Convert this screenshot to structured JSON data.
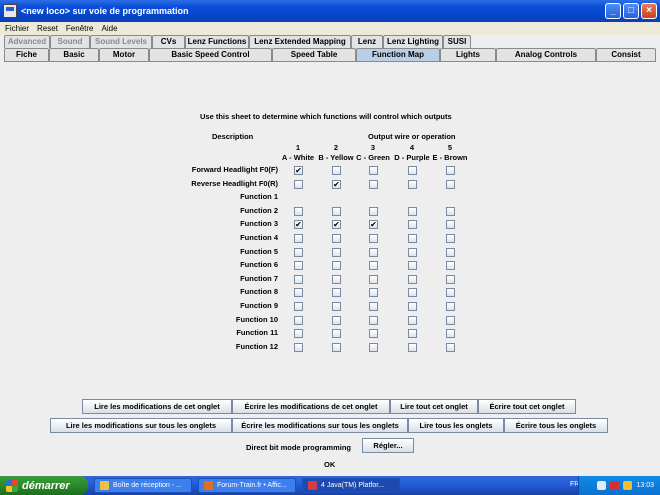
{
  "window": {
    "title": "<new loco> sur voie de programmation"
  },
  "menu": [
    "Fichier",
    "Reset",
    "Fenêtre",
    "Aide"
  ],
  "tabs_row1": [
    {
      "label": "Advanced",
      "enabled": false
    },
    {
      "label": "Sound",
      "enabled": false
    },
    {
      "label": "Sound Levels",
      "enabled": false
    },
    {
      "label": "CVs",
      "enabled": true
    },
    {
      "label": "Lenz Functions",
      "enabled": true
    },
    {
      "label": "Lenz Extended Mapping",
      "enabled": true
    },
    {
      "label": "Lenz",
      "enabled": true
    },
    {
      "label": "Lenz Lighting",
      "enabled": true
    },
    {
      "label": "SUSI",
      "enabled": true
    }
  ],
  "tabs_row2": [
    "Fiche",
    "Basic",
    "Motor",
    "Basic Speed Control",
    "Speed Table",
    "Function Map",
    "Lights",
    "Analog Controls",
    "Consist"
  ],
  "active_tab": "Function Map",
  "function_map": {
    "instructions": "Use this sheet to determine which functions will control which outputs",
    "description_header": "Description",
    "output_header": "Output wire or operation",
    "columns": [
      {
        "num": "1",
        "label": "A - White"
      },
      {
        "num": "2",
        "label": "B - Yellow"
      },
      {
        "num": "3",
        "label": "C - Green"
      },
      {
        "num": "4",
        "label": "D - Purple"
      },
      {
        "num": "5",
        "label": "E - Brown"
      }
    ],
    "rows": [
      {
        "label": "Forward Headlight F0(F)",
        "checks": [
          true,
          false,
          false,
          false,
          false
        ]
      },
      {
        "label": "Reverse Headlight F0(R)",
        "checks": [
          false,
          true,
          false,
          false,
          false
        ]
      },
      {
        "label": "Function 1",
        "checks": null
      },
      {
        "label": "Function 2",
        "checks": [
          false,
          false,
          false,
          false,
          false
        ]
      },
      {
        "label": "Function 3",
        "checks": [
          true,
          true,
          true,
          false,
          false
        ]
      },
      {
        "label": "Function 4",
        "checks": [
          false,
          false,
          false,
          false,
          false
        ]
      },
      {
        "label": "Function 5",
        "checks": [
          false,
          false,
          false,
          false,
          false
        ]
      },
      {
        "label": "Function 6",
        "checks": [
          false,
          false,
          false,
          false,
          false
        ]
      },
      {
        "label": "Function 7",
        "checks": [
          false,
          false,
          false,
          false,
          false
        ]
      },
      {
        "label": "Function 8",
        "checks": [
          false,
          false,
          false,
          false,
          false
        ]
      },
      {
        "label": "Function 9",
        "checks": [
          false,
          false,
          false,
          false,
          false
        ]
      },
      {
        "label": "Function 10",
        "checks": [
          false,
          false,
          false,
          false,
          false
        ]
      },
      {
        "label": "Function 11",
        "checks": [
          false,
          false,
          false,
          false,
          false
        ]
      },
      {
        "label": "Function 12",
        "checks": [
          false,
          false,
          false,
          false,
          false
        ]
      }
    ]
  },
  "buttons": {
    "read_changes_tab": "Lire les modifications de cet onglet",
    "write_changes_tab": "Écrire les modifications de cet onglet",
    "read_all_tab": "Lire tout cet onglet",
    "write_all_tab": "Écrire tout cet onglet",
    "read_changes_all": "Lire les modifications sur tous les onglets",
    "write_changes_all": "Écrire les modifications sur tous les onglets",
    "read_all_tabs": "Lire tous les onglets",
    "write_all_tabs": "Écrire tous les onglets",
    "set": "Régler..."
  },
  "mode_label": "Direct bit mode programming",
  "ok_label": "OK",
  "taskbar": {
    "start": "démarrer",
    "tasks": [
      "Boîte de réception - ...",
      "Forum-Train.fr • Affic...",
      "4 Java(TM) Platfor..."
    ],
    "lang": "FR",
    "clock": "13:03"
  }
}
